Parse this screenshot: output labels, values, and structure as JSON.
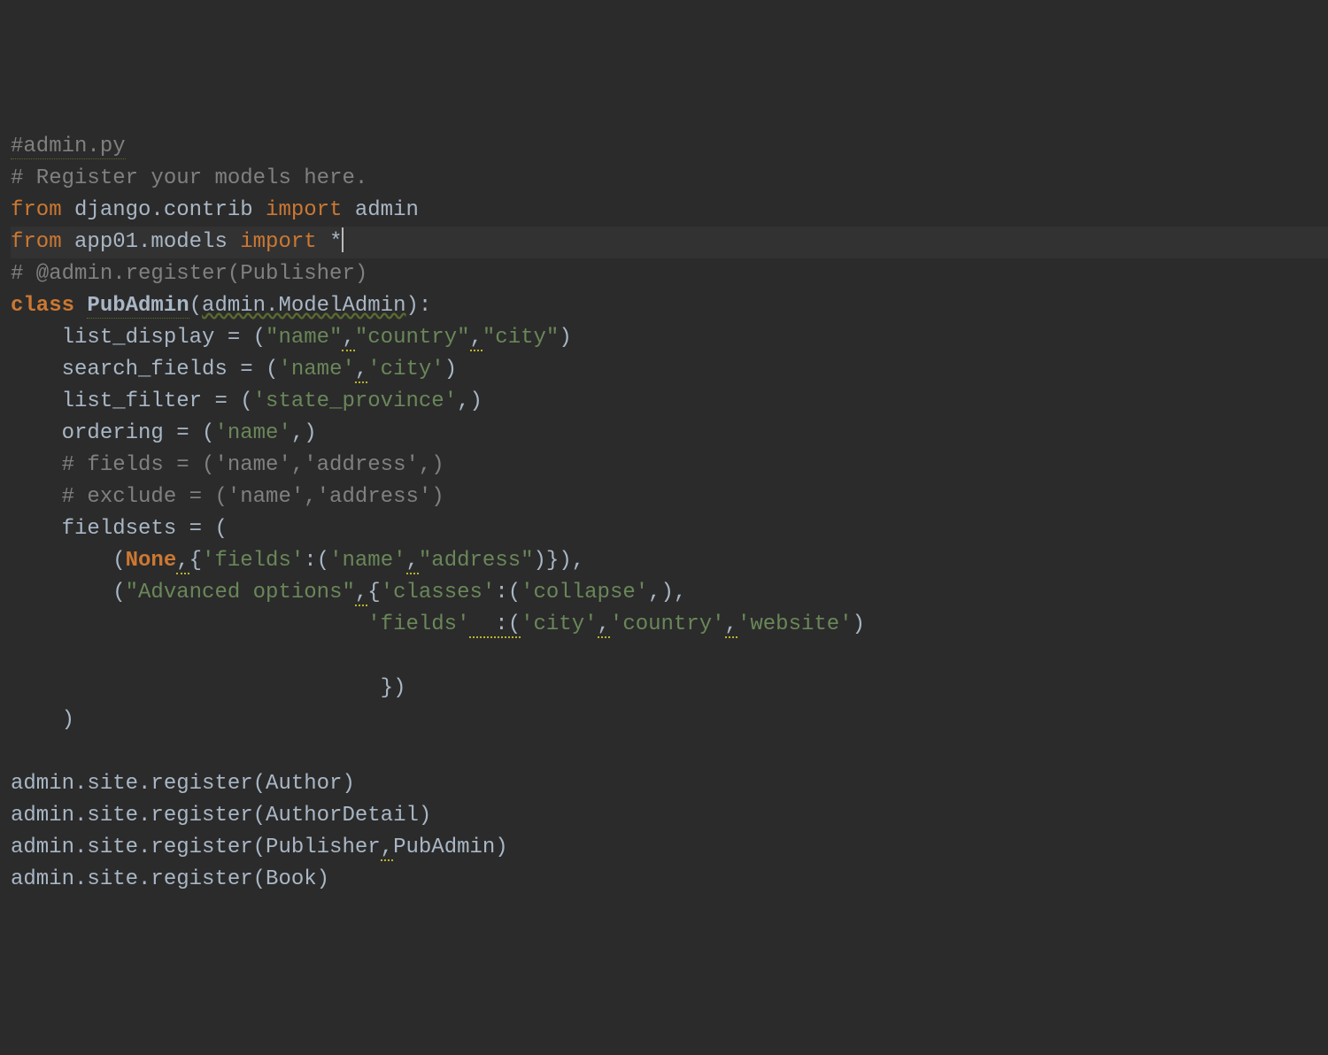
{
  "code": {
    "lines": [
      {
        "type": "comment-typo",
        "text": "#admin.py"
      },
      {
        "type": "comment",
        "text": "# Register your models here."
      },
      {
        "type": "import",
        "tokens": [
          {
            "cls": "kw",
            "t": "from"
          },
          {
            "cls": "fn",
            "t": " django.contrib "
          },
          {
            "cls": "kw",
            "t": "import"
          },
          {
            "cls": "fn",
            "t": " admin"
          }
        ]
      },
      {
        "type": "import-current",
        "tokens": [
          {
            "cls": "kw",
            "t": "from"
          },
          {
            "cls": "fn",
            "t": " app01.models "
          },
          {
            "cls": "kw",
            "t": "import"
          },
          {
            "cls": "fn",
            "t": " *"
          }
        ]
      },
      {
        "type": "comment",
        "text": "# @admin.register(Publisher)"
      },
      {
        "type": "classdef",
        "tokens": [
          {
            "cls": "kw-b",
            "t": "class "
          },
          {
            "cls": "cls",
            "t": "PubAdmin"
          },
          {
            "cls": "pn",
            "t": "("
          },
          {
            "cls": "fn",
            "t": "admin.ModelAdmin"
          },
          {
            "cls": "pn",
            "t": "):"
          }
        ]
      },
      {
        "type": "assign",
        "indent": "    ",
        "tokens": [
          {
            "cls": "fn",
            "t": "list_display = ("
          },
          {
            "cls": "str",
            "t": "\"name\""
          },
          {
            "cls": "warn",
            "t": ","
          },
          {
            "cls": "str",
            "t": "\"country\""
          },
          {
            "cls": "warn",
            "t": ","
          },
          {
            "cls": "str",
            "t": "\"city\""
          },
          {
            "cls": "fn",
            "t": ")"
          }
        ]
      },
      {
        "type": "assign",
        "indent": "    ",
        "tokens": [
          {
            "cls": "fn",
            "t": "search_fields = ("
          },
          {
            "cls": "str",
            "t": "'name'"
          },
          {
            "cls": "warn",
            "t": ","
          },
          {
            "cls": "str",
            "t": "'city'"
          },
          {
            "cls": "fn",
            "t": ")"
          }
        ]
      },
      {
        "type": "assign",
        "indent": "    ",
        "tokens": [
          {
            "cls": "fn",
            "t": "list_filter = ("
          },
          {
            "cls": "str",
            "t": "'state_province'"
          },
          {
            "cls": "fn",
            "t": ",)"
          }
        ]
      },
      {
        "type": "assign",
        "indent": "    ",
        "tokens": [
          {
            "cls": "fn",
            "t": "ordering = ("
          },
          {
            "cls": "str",
            "t": "'name'"
          },
          {
            "cls": "fn",
            "t": ",)"
          }
        ]
      },
      {
        "type": "comment",
        "indent": "    ",
        "text": "# fields = ('name','address',)"
      },
      {
        "type": "comment",
        "indent": "    ",
        "text": "# exclude = ('name','address')"
      },
      {
        "type": "assign",
        "indent": "    ",
        "tokens": [
          {
            "cls": "fn",
            "t": "fieldsets = ("
          }
        ]
      },
      {
        "type": "assign",
        "indent": "        ",
        "tokens": [
          {
            "cls": "fn",
            "t": "("
          },
          {
            "cls": "bi",
            "t": "None"
          },
          {
            "cls": "warn",
            "t": ","
          },
          {
            "cls": "fn",
            "t": "{"
          },
          {
            "cls": "str",
            "t": "'fields'"
          },
          {
            "cls": "fn",
            "t": ":("
          },
          {
            "cls": "str",
            "t": "'name'"
          },
          {
            "cls": "warn",
            "t": ","
          },
          {
            "cls": "str",
            "t": "\"address\""
          },
          {
            "cls": "fn",
            "t": ")}),"
          }
        ]
      },
      {
        "type": "assign",
        "indent": "        ",
        "tokens": [
          {
            "cls": "fn",
            "t": "("
          },
          {
            "cls": "str",
            "t": "\"Advanced options\""
          },
          {
            "cls": "warn",
            "t": ","
          },
          {
            "cls": "fn",
            "t": "{"
          },
          {
            "cls": "str",
            "t": "'classes'"
          },
          {
            "cls": "fn",
            "t": ":("
          },
          {
            "cls": "str",
            "t": "'collapse'"
          },
          {
            "cls": "fn",
            "t": ",),"
          }
        ]
      },
      {
        "type": "assign",
        "indent": "                            ",
        "tokens": [
          {
            "cls": "str",
            "t": "'fields'"
          },
          {
            "cls": "fn",
            "t": "  :("
          },
          {
            "cls": "str",
            "t": "'city'"
          },
          {
            "cls": "warn",
            "t": ","
          },
          {
            "cls": "str",
            "t": "'country'"
          },
          {
            "cls": "warn",
            "t": ","
          },
          {
            "cls": "str",
            "t": "'website'"
          },
          {
            "cls": "fn",
            "t": ")"
          }
        ]
      },
      {
        "type": "blank",
        "text": ""
      },
      {
        "type": "assign",
        "indent": "                             ",
        "tokens": [
          {
            "cls": "fn",
            "t": "})"
          }
        ]
      },
      {
        "type": "assign",
        "indent": "    ",
        "tokens": [
          {
            "cls": "fn",
            "t": ")"
          }
        ]
      },
      {
        "type": "blank",
        "text": ""
      },
      {
        "type": "call",
        "tokens": [
          {
            "cls": "fn",
            "t": "admin.site.register(Author)"
          }
        ]
      },
      {
        "type": "call",
        "tokens": [
          {
            "cls": "fn",
            "t": "admin.site.register(AuthorDetail)"
          }
        ]
      },
      {
        "type": "call",
        "tokens": [
          {
            "cls": "fn",
            "t": "admin.site.register(Publisher"
          },
          {
            "cls": "warn",
            "t": ","
          },
          {
            "cls": "fn",
            "t": "PubAdmin)"
          }
        ]
      },
      {
        "type": "call",
        "tokens": [
          {
            "cls": "fn",
            "t": "admin.site.register(Book)"
          }
        ]
      }
    ]
  }
}
